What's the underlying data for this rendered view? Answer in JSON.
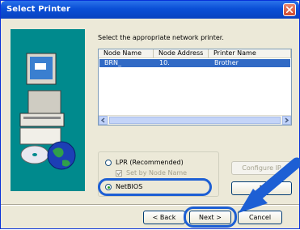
{
  "window": {
    "title": "Select Printer"
  },
  "instruction": "Select the appropriate network printer.",
  "list": {
    "columns": [
      "Node Name",
      "Node Address",
      "Printer Name"
    ],
    "rows": [
      {
        "node_name": "BRN_",
        "node_address": "10.",
        "printer_name": "Brother",
        "selected": true
      }
    ]
  },
  "connection": {
    "lpr_label": "LPR (Recommended)",
    "set_by_node_label": "Set by Node Name",
    "netbios_label": "NetBIOS",
    "selected": "NetBIOS"
  },
  "buttons": {
    "configure_ip": "Configure IP",
    "refresh": "R",
    "back": "< Back",
    "next": "Next >",
    "cancel": "Cancel"
  },
  "colors": {
    "titlebar": "#0a4fd6",
    "selection": "#316ac5",
    "highlight": "#1d5fd4",
    "art_bg": "#008a8d"
  },
  "icons": [
    "close-icon",
    "computer-printer-illustration",
    "globe-icon",
    "cd-disc-icon",
    "scroll-left-icon",
    "scroll-right-icon",
    "pointer-arrow"
  ]
}
